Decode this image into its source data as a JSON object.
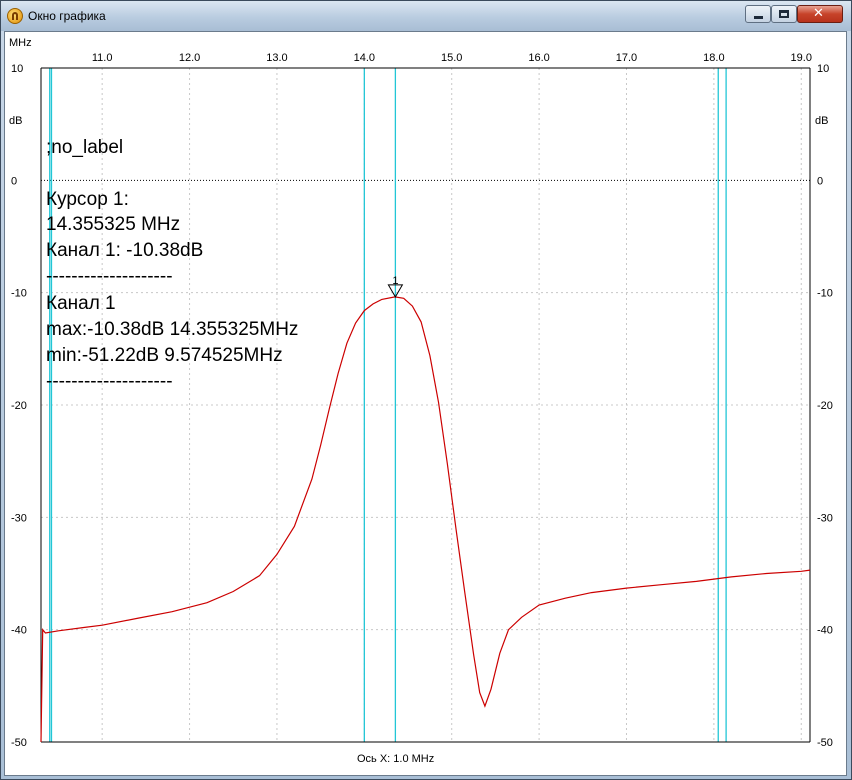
{
  "window": {
    "title": "Окно графика",
    "icon": "oscilloscope-app-icon"
  },
  "chart_data": {
    "type": "line",
    "x_unit": "MHz",
    "y_unit": "dB",
    "xlim": [
      10.3,
      19.1
    ],
    "ylim": [
      -50,
      10
    ],
    "x_ticks": [
      11.0,
      12.0,
      13.0,
      14.0,
      15.0,
      16.0,
      17.0,
      18.0,
      19.0
    ],
    "x_tick_labels": [
      "11.0",
      "12.0",
      "13.0",
      "14.0",
      "15.0",
      "16.0",
      "17.0",
      "18.0",
      "19.0"
    ],
    "y_ticks": [
      10,
      0,
      -10,
      -20,
      -30,
      -40,
      -50
    ],
    "y_tick_labels": [
      "10",
      "0",
      "-10",
      "-20",
      "-30",
      "-40",
      "-50"
    ],
    "xlabel": "Ось X: 1.0 MHz",
    "grid": true,
    "series": [
      {
        "color": "#cc0000",
        "x": [
          10.3,
          10.32,
          10.35,
          10.5,
          10.8,
          11.0,
          11.4,
          11.8,
          12.2,
          12.5,
          12.8,
          13.0,
          13.2,
          13.4,
          13.5,
          13.6,
          13.7,
          13.8,
          13.9,
          14.0,
          14.1,
          14.2,
          14.35,
          14.45,
          14.55,
          14.65,
          14.75,
          14.85,
          14.95,
          15.05,
          15.15,
          15.25,
          15.32,
          15.38,
          15.45,
          15.55,
          15.65,
          15.8,
          16.0,
          16.3,
          16.6,
          17.0,
          17.4,
          17.8,
          18.2,
          18.6,
          19.0,
          19.1
        ],
        "y": [
          -50.0,
          -40.0,
          -40.3,
          -40.1,
          -39.8,
          -39.6,
          -39.0,
          -38.4,
          -37.6,
          -36.6,
          -35.2,
          -33.3,
          -30.8,
          -26.6,
          -23.6,
          -20.3,
          -17.2,
          -14.5,
          -12.7,
          -11.6,
          -11.0,
          -10.6,
          -10.38,
          -10.5,
          -11.2,
          -12.6,
          -15.6,
          -19.8,
          -25.2,
          -31.1,
          -36.7,
          -42.2,
          -45.6,
          -46.8,
          -45.3,
          -42.1,
          -40.0,
          -38.9,
          -37.8,
          -37.2,
          -36.7,
          -36.3,
          -36.0,
          -35.7,
          -35.3,
          -35.0,
          -34.8,
          -34.7
        ]
      }
    ],
    "cursor_lines_mhz": [
      10.4,
      10.42,
      14.0,
      14.355325,
      18.05,
      18.14
    ],
    "marker": {
      "x": 14.355325,
      "y": -10.38,
      "label": "1"
    }
  },
  "info_panel": {
    "label": ";no_label",
    "cursor_title": "Курсор 1:",
    "cursor_freq": "14.355325 MHz",
    "cursor_channel": "Канал 1:  -10.38dB",
    "separator": "--------------------",
    "channel_title": "Канал 1",
    "max_line": "max:-10.38dB 14.355325MHz",
    "min_line": "min:-51.22dB 9.574525MHz",
    "separator2": "--------------------"
  }
}
